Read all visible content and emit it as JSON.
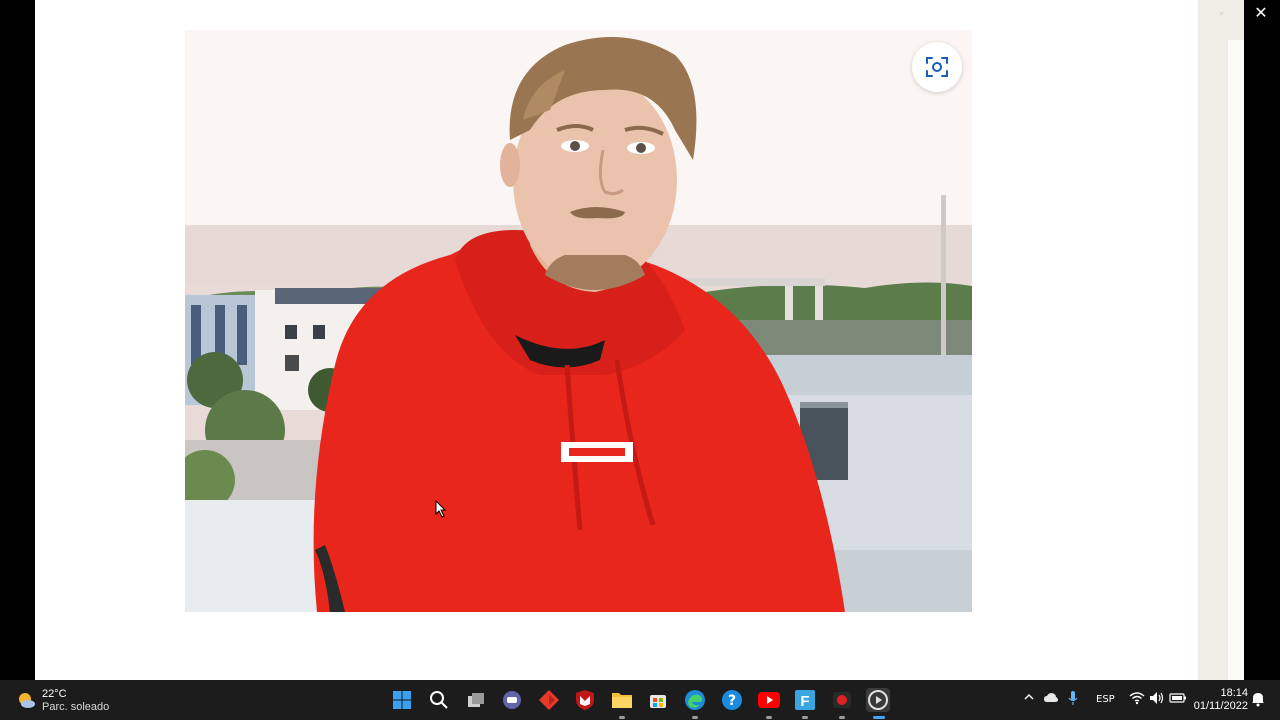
{
  "window": {
    "close_glyph": "✕"
  },
  "viewer": {
    "image_subject": "photo",
    "visual_search_icon": "visual-search-icon"
  },
  "taskbar": {
    "weather": {
      "temperature": "22°C",
      "condition": "Parc. soleado"
    },
    "apps": [
      {
        "name": "start",
        "icon": "windows-logo-icon"
      },
      {
        "name": "search",
        "icon": "search-icon"
      },
      {
        "name": "task-view",
        "icon": "task-view-icon"
      },
      {
        "name": "teams-chat",
        "icon": "chat-icon"
      },
      {
        "name": "diamond-app",
        "icon": "diamond-icon"
      },
      {
        "name": "mcafee",
        "icon": "mcafee-icon"
      },
      {
        "name": "file-explorer",
        "icon": "folder-icon"
      },
      {
        "name": "store",
        "icon": "store-icon"
      },
      {
        "name": "edge",
        "icon": "edge-icon"
      },
      {
        "name": "help",
        "icon": "help-icon"
      },
      {
        "name": "youtube",
        "icon": "youtube-icon"
      },
      {
        "name": "f-app",
        "icon": "f-app-icon"
      },
      {
        "name": "recorder",
        "icon": "recorder-icon"
      },
      {
        "name": "media-player",
        "icon": "media-player-icon"
      }
    ],
    "tray": {
      "language": "ESP",
      "time": "18:14",
      "date": "01/11/2022"
    }
  },
  "colors": {
    "taskbar_bg": "#1c1c1c",
    "hoodie_red": "#e8261c",
    "accent_blue": "#0078d4"
  }
}
